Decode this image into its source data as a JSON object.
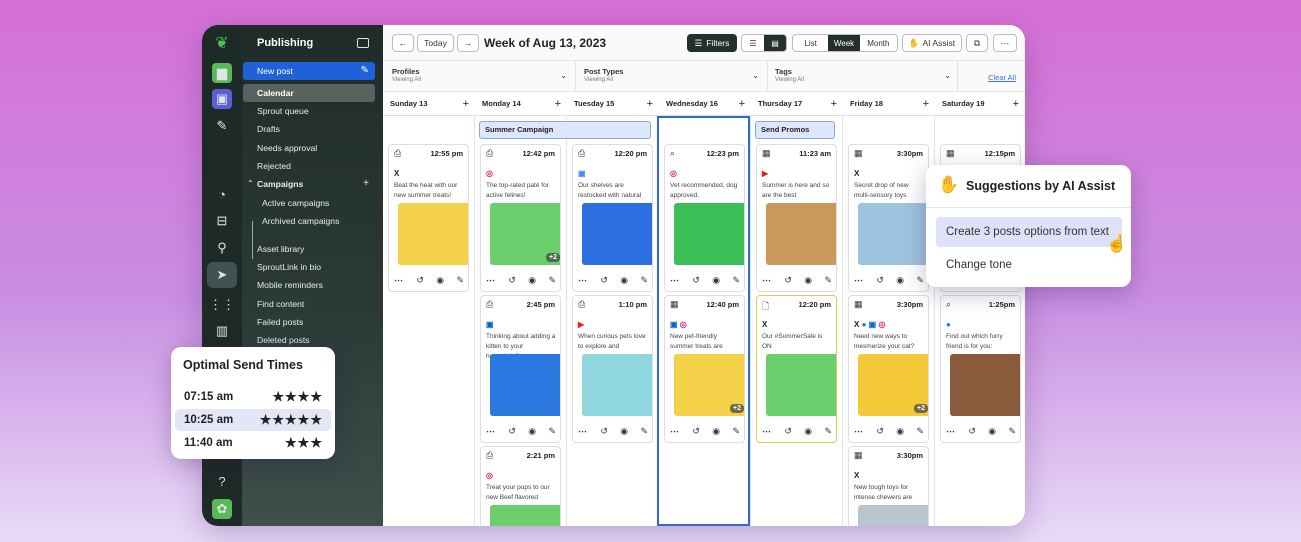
{
  "nav": {
    "title": "Publishing",
    "new_post": "New post",
    "items": [
      "Calendar",
      "Sprout queue",
      "Drafts",
      "Needs approval",
      "Rejected"
    ],
    "campaigns": "Campaigns",
    "campaign_items": [
      "Active campaigns",
      "Archived campaigns"
    ],
    "more": [
      "Asset library",
      "SproutLink in bio",
      "Mobile reminders",
      "Find content",
      "Failed posts",
      "Deleted posts"
    ]
  },
  "toolbar": {
    "today": "Today",
    "week_title": "Week of Aug 13, 2023",
    "filters": "Filters",
    "list": "List",
    "week": "Week",
    "month": "Month",
    "ai_assist": "AI Assist"
  },
  "filters": {
    "profiles": "Profiles",
    "post_types": "Post Types",
    "tags": "Tags",
    "viewing": "Viewing All",
    "clear": "Clear All"
  },
  "days": [
    "Sunday 13",
    "Monday 14",
    "Tuesday 15",
    "Wednesday 16",
    "Thursday 17",
    "Friday 18",
    "Saturday 19"
  ],
  "campaign_bands": {
    "summer": "Summer Campaign",
    "promos": "Send Promos"
  },
  "posts": [
    {
      "time": "12:55 pm",
      "net": "X",
      "text": "Beat the heat with our new summer treats!"
    },
    {
      "time": "12:42 pm",
      "net": "IG",
      "text": "The top-rated paté for active felines!",
      "count": "+2"
    },
    {
      "time": "12:20 pm",
      "net": "GBP",
      "text": "Our shelves are restocked with natural"
    },
    {
      "time": "12:23 pm",
      "net": "IG",
      "text": "Vet recommended, dog approved."
    },
    {
      "time": "11:23 am",
      "net": "YT",
      "text": "Summer is here and so are the best"
    },
    {
      "time": "3:30pm",
      "net": "X",
      "text": "Secret drop of new multi-sensory toys"
    },
    {
      "time": "12:15pm",
      "net": "",
      "text": ""
    },
    {
      "time": "2:45 pm",
      "net": "IN",
      "text": "Thinking about adding a kitten to your household?"
    },
    {
      "time": "1:10 pm",
      "net": "YT",
      "text": "When curious pets love to explore and"
    },
    {
      "time": "12:40 pm",
      "net": "IN IG",
      "text": "New pet-friendly summer treats are",
      "count": "+2"
    },
    {
      "time": "12:20 pm",
      "net": "X",
      "text": "Our #SummerSale is ON"
    },
    {
      "time": "3:30pm",
      "net": "X FB IN IG",
      "text": "Need new ways to mesmerize your cat?",
      "count": "+2"
    },
    {
      "time": "1:25pm",
      "net": "FB",
      "text": "Find out which furry friend is for you:"
    },
    {
      "time": "2:21 pm",
      "net": "IG",
      "text": "Treat your pups to our new Beef flavored"
    },
    {
      "time": "3:30pm",
      "net": "X",
      "text": "New tough toys for intense chewers are"
    }
  ],
  "optimal": {
    "title": "Optimal Send Times",
    "rows": [
      {
        "time": "07:15 am",
        "stars": "★★★★"
      },
      {
        "time": "10:25 am",
        "stars": "★★★★★"
      },
      {
        "time": "11:40 am",
        "stars": "★★★"
      }
    ]
  },
  "ai": {
    "title": "Suggestions by AI Assist",
    "options": [
      "Create 3 posts options from text",
      "Change tone"
    ]
  },
  "colors": {
    "accent": "#2060d8",
    "sidebar": "#1f2b28",
    "selected_day": "#2f6ad0"
  }
}
